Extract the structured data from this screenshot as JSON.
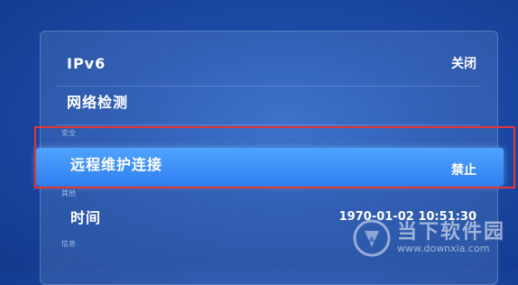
{
  "settings": {
    "rows": [
      {
        "label": "IPv6",
        "value": "关闭"
      },
      {
        "label": "网络检测",
        "value": ""
      },
      {
        "label": "远程维护连接",
        "value": "禁止"
      },
      {
        "label": "时间",
        "value": "1970-01-02 10:51:30"
      }
    ],
    "sections": [
      "安全",
      "其他",
      "信息"
    ]
  },
  "watermark": {
    "name": "当下软件园",
    "url": "www.downxia.com"
  },
  "colors": {
    "background": "#1b4aa6",
    "selected_row": "#3a8cf5",
    "highlight_border": "#e23636"
  }
}
